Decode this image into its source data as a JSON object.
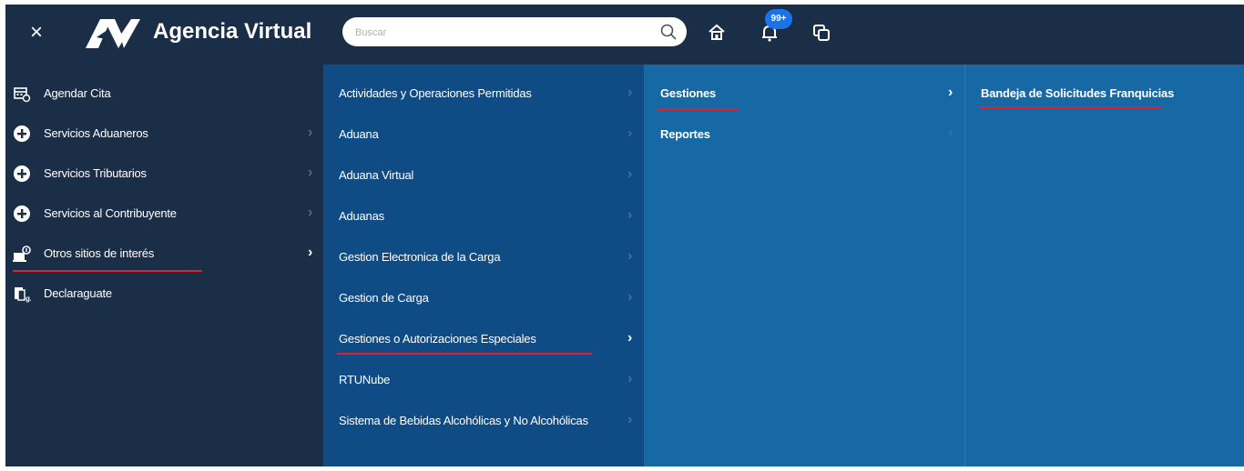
{
  "header": {
    "close_glyph": "×",
    "app_title": "Agencia Virtual",
    "logo_text": "AV",
    "search_placeholder": "Buscar",
    "search_value": "",
    "notification_count": "99+",
    "icons": [
      "close-icon",
      "search-icon",
      "home-icon",
      "bell-icon",
      "copy-icon"
    ]
  },
  "menu_level1": [
    {
      "label": "Agendar Cita",
      "icon": "calendar-icon",
      "has_submenu": false
    },
    {
      "label": "Servicios Aduaneros",
      "icon": "plus-circle-icon",
      "has_submenu": true
    },
    {
      "label": "Servicios Tributarios",
      "icon": "plus-circle-icon",
      "has_submenu": true
    },
    {
      "label": "Servicios al Contribuyente",
      "icon": "plus-circle-icon",
      "has_submenu": true
    },
    {
      "label": "Otros sitios de interés",
      "icon": "sites-icon",
      "has_submenu": true,
      "active": true
    },
    {
      "label": "Declaraguate",
      "icon": "declaraguate-icon",
      "has_submenu": false
    }
  ],
  "menu_level2": [
    {
      "label": "Actividades y Operaciones Permitidas"
    },
    {
      "label": "Aduana"
    },
    {
      "label": "Aduana Virtual"
    },
    {
      "label": "Aduanas"
    },
    {
      "label": "Gestion Electronica de la Carga"
    },
    {
      "label": "Gestion de Carga"
    },
    {
      "label": "Gestiones o Autorizaciones Especiales",
      "active": true
    },
    {
      "label": "RTUNube"
    },
    {
      "label": "Sistema de Bebidas Alcohólicas y No Alcohólicas"
    }
  ],
  "menu_level3": [
    {
      "label": "Gestiones",
      "active": true
    },
    {
      "label": "Reportes"
    }
  ],
  "menu_level4": [
    {
      "label": "Bandeja de Solicitudes Franquicias",
      "active": true
    }
  ],
  "colors": {
    "header_bg": "#1b2e48",
    "level2_bg": "#0f4b85",
    "level3_bg": "#1769a6",
    "accent_underline": "#e0202a",
    "badge_bg": "#1a73e8"
  }
}
